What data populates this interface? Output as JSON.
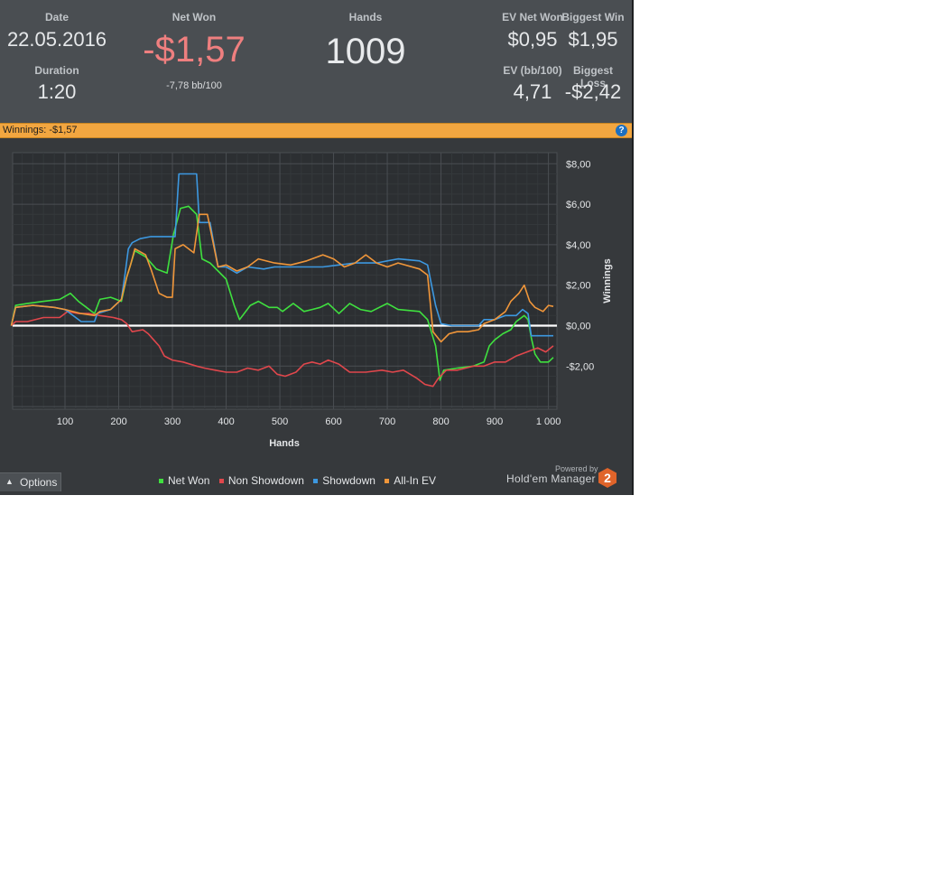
{
  "stats": {
    "date_label": "Date",
    "date_value": "22.05.2016",
    "duration_label": "Duration",
    "duration_value": "1:20",
    "net_won_label": "Net Won",
    "net_won_value": "-$1,57",
    "net_won_bb": "-7,78 bb/100",
    "hands_label": "Hands",
    "hands_value": "1009",
    "ev_net_won_label": "EV Net Won",
    "ev_net_won_value": "$0,95",
    "biggest_win_label": "Biggest Win",
    "biggest_win_value": "$1,95",
    "ev_bb_label": "EV (bb/100)",
    "ev_bb_value": "4,71",
    "biggest_loss_label": "Biggest Loss",
    "biggest_loss_value": "-$2,42"
  },
  "winnings_bar": {
    "label": "Winnings:",
    "value": "-$1,57",
    "help_icon": "help-icon"
  },
  "footer": {
    "options_label": "Options",
    "powered_by": "Powered by",
    "brand_name": "Hold'em Manager",
    "brand_badge": "2"
  },
  "colors": {
    "net_won": "#3fe03f",
    "non_showdown": "#e0474c",
    "showdown": "#3d98e0",
    "all_in_ev": "#f0963a",
    "negative_value": "#ef7f7f",
    "accent_bar": "#f2a640"
  },
  "chart_data": {
    "type": "line",
    "xlabel": "Hands",
    "ylabel": "Winnings",
    "xlim": [
      0,
      1009
    ],
    "ylim": [
      -4.2,
      8.5
    ],
    "x_ticks": [
      100,
      200,
      300,
      400,
      500,
      600,
      700,
      800,
      900,
      1000
    ],
    "x_tick_labels": [
      "100",
      "200",
      "300",
      "400",
      "500",
      "600",
      "700",
      "800",
      "900",
      "1 000"
    ],
    "y_ticks": [
      8,
      6,
      4,
      2,
      0,
      -2
    ],
    "y_tick_labels": [
      "$8,00",
      "$6,00",
      "$4,00",
      "$2,00",
      "$0,00",
      "-$2,00"
    ],
    "grid": true,
    "legend_position": "bottom",
    "series": [
      {
        "name": "Net Won",
        "color_key": "net_won",
        "points": [
          [
            0,
            0
          ],
          [
            8,
            1.0
          ],
          [
            30,
            1.1
          ],
          [
            60,
            1.2
          ],
          [
            90,
            1.3
          ],
          [
            110,
            1.6
          ],
          [
            125,
            1.2
          ],
          [
            140,
            0.9
          ],
          [
            155,
            0.6
          ],
          [
            165,
            1.3
          ],
          [
            185,
            1.4
          ],
          [
            205,
            1.2
          ],
          [
            215,
            2.4
          ],
          [
            222,
            3.0
          ],
          [
            230,
            3.7
          ],
          [
            250,
            3.4
          ],
          [
            270,
            2.8
          ],
          [
            290,
            2.6
          ],
          [
            302,
            4.5
          ],
          [
            315,
            5.8
          ],
          [
            330,
            5.9
          ],
          [
            345,
            5.5
          ],
          [
            355,
            3.3
          ],
          [
            370,
            3.1
          ],
          [
            385,
            2.7
          ],
          [
            400,
            2.3
          ],
          [
            415,
            1.0
          ],
          [
            425,
            0.3
          ],
          [
            445,
            1.0
          ],
          [
            460,
            1.2
          ],
          [
            480,
            0.9
          ],
          [
            495,
            0.9
          ],
          [
            505,
            0.7
          ],
          [
            525,
            1.1
          ],
          [
            545,
            0.7
          ],
          [
            560,
            0.8
          ],
          [
            575,
            0.9
          ],
          [
            590,
            1.1
          ],
          [
            610,
            0.6
          ],
          [
            630,
            1.1
          ],
          [
            650,
            0.8
          ],
          [
            670,
            0.7
          ],
          [
            700,
            1.1
          ],
          [
            720,
            0.8
          ],
          [
            760,
            0.7
          ],
          [
            775,
            0.3
          ],
          [
            790,
            -1.0
          ],
          [
            798,
            -2.7
          ],
          [
            805,
            -2.2
          ],
          [
            830,
            -2.1
          ],
          [
            860,
            -2.0
          ],
          [
            880,
            -1.8
          ],
          [
            890,
            -1.0
          ],
          [
            900,
            -0.7
          ],
          [
            915,
            -0.4
          ],
          [
            930,
            -0.2
          ],
          [
            940,
            0.2
          ],
          [
            955,
            0.5
          ],
          [
            962,
            0.3
          ],
          [
            968,
            -0.6
          ],
          [
            975,
            -1.4
          ],
          [
            985,
            -1.8
          ],
          [
            1000,
            -1.8
          ],
          [
            1009,
            -1.57
          ]
        ]
      },
      {
        "name": "Non Showdown",
        "color_key": "non_showdown",
        "points": [
          [
            0,
            0
          ],
          [
            8,
            0.2
          ],
          [
            30,
            0.2
          ],
          [
            60,
            0.4
          ],
          [
            90,
            0.4
          ],
          [
            105,
            0.7
          ],
          [
            125,
            0.6
          ],
          [
            145,
            0.6
          ],
          [
            165,
            0.5
          ],
          [
            190,
            0.4
          ],
          [
            205,
            0.3
          ],
          [
            215,
            0.1
          ],
          [
            225,
            -0.3
          ],
          [
            245,
            -0.2
          ],
          [
            255,
            -0.4
          ],
          [
            265,
            -0.7
          ],
          [
            275,
            -1.0
          ],
          [
            285,
            -1.5
          ],
          [
            300,
            -1.7
          ],
          [
            320,
            -1.8
          ],
          [
            345,
            -2.0
          ],
          [
            360,
            -2.1
          ],
          [
            380,
            -2.2
          ],
          [
            400,
            -2.3
          ],
          [
            420,
            -2.3
          ],
          [
            440,
            -2.1
          ],
          [
            460,
            -2.2
          ],
          [
            480,
            -2.0
          ],
          [
            495,
            -2.4
          ],
          [
            510,
            -2.5
          ],
          [
            530,
            -2.3
          ],
          [
            545,
            -1.9
          ],
          [
            560,
            -1.8
          ],
          [
            575,
            -1.9
          ],
          [
            590,
            -1.7
          ],
          [
            610,
            -1.9
          ],
          [
            630,
            -2.3
          ],
          [
            660,
            -2.3
          ],
          [
            690,
            -2.2
          ],
          [
            710,
            -2.3
          ],
          [
            730,
            -2.2
          ],
          [
            755,
            -2.6
          ],
          [
            770,
            -2.9
          ],
          [
            785,
            -3.0
          ],
          [
            795,
            -2.6
          ],
          [
            810,
            -2.2
          ],
          [
            830,
            -2.2
          ],
          [
            860,
            -2.0
          ],
          [
            880,
            -2.0
          ],
          [
            900,
            -1.8
          ],
          [
            920,
            -1.8
          ],
          [
            940,
            -1.5
          ],
          [
            960,
            -1.3
          ],
          [
            980,
            -1.1
          ],
          [
            995,
            -1.3
          ],
          [
            1009,
            -1.0
          ]
        ]
      },
      {
        "name": "Showdown",
        "color_key": "showdown",
        "points": [
          [
            0,
            0
          ],
          [
            8,
            0.9
          ],
          [
            40,
            1.0
          ],
          [
            80,
            0.9
          ],
          [
            100,
            0.8
          ],
          [
            130,
            0.2
          ],
          [
            155,
            0.2
          ],
          [
            160,
            0.6
          ],
          [
            185,
            0.8
          ],
          [
            205,
            1.3
          ],
          [
            212,
            2.6
          ],
          [
            218,
            3.8
          ],
          [
            225,
            4.1
          ],
          [
            240,
            4.3
          ],
          [
            260,
            4.4
          ],
          [
            290,
            4.4
          ],
          [
            305,
            4.4
          ],
          [
            312,
            7.5
          ],
          [
            345,
            7.5
          ],
          [
            350,
            5.1
          ],
          [
            370,
            5.1
          ],
          [
            385,
            2.9
          ],
          [
            400,
            2.9
          ],
          [
            420,
            2.6
          ],
          [
            440,
            2.9
          ],
          [
            470,
            2.8
          ],
          [
            490,
            2.9
          ],
          [
            520,
            2.9
          ],
          [
            550,
            2.9
          ],
          [
            580,
            2.9
          ],
          [
            610,
            3.0
          ],
          [
            640,
            3.1
          ],
          [
            660,
            3.1
          ],
          [
            680,
            3.1
          ],
          [
            700,
            3.2
          ],
          [
            720,
            3.3
          ],
          [
            760,
            3.2
          ],
          [
            775,
            3.0
          ],
          [
            790,
            1.0
          ],
          [
            800,
            0.1
          ],
          [
            820,
            0.0
          ],
          [
            850,
            0.0
          ],
          [
            870,
            0.0
          ],
          [
            880,
            0.3
          ],
          [
            900,
            0.3
          ],
          [
            920,
            0.5
          ],
          [
            940,
            0.5
          ],
          [
            952,
            0.8
          ],
          [
            962,
            0.6
          ],
          [
            968,
            -0.5
          ],
          [
            990,
            -0.5
          ],
          [
            1009,
            -0.5
          ]
        ]
      },
      {
        "name": "All-In EV",
        "color_key": "all_in_ev",
        "points": [
          [
            0,
            0
          ],
          [
            8,
            0.9
          ],
          [
            40,
            1.0
          ],
          [
            80,
            0.9
          ],
          [
            100,
            0.8
          ],
          [
            130,
            0.6
          ],
          [
            155,
            0.5
          ],
          [
            165,
            0.7
          ],
          [
            185,
            0.8
          ],
          [
            205,
            1.3
          ],
          [
            215,
            2.4
          ],
          [
            222,
            3.0
          ],
          [
            230,
            3.8
          ],
          [
            250,
            3.5
          ],
          [
            260,
            2.8
          ],
          [
            275,
            1.6
          ],
          [
            290,
            1.4
          ],
          [
            300,
            1.4
          ],
          [
            305,
            3.8
          ],
          [
            320,
            4.0
          ],
          [
            340,
            3.6
          ],
          [
            350,
            5.5
          ],
          [
            365,
            5.5
          ],
          [
            385,
            2.9
          ],
          [
            400,
            3.0
          ],
          [
            420,
            2.7
          ],
          [
            440,
            2.9
          ],
          [
            460,
            3.3
          ],
          [
            490,
            3.1
          ],
          [
            520,
            3.0
          ],
          [
            550,
            3.2
          ],
          [
            580,
            3.5
          ],
          [
            600,
            3.3
          ],
          [
            620,
            2.9
          ],
          [
            640,
            3.1
          ],
          [
            660,
            3.5
          ],
          [
            680,
            3.1
          ],
          [
            700,
            2.9
          ],
          [
            720,
            3.1
          ],
          [
            760,
            2.8
          ],
          [
            775,
            2.5
          ],
          [
            785,
            -0.3
          ],
          [
            800,
            -0.8
          ],
          [
            815,
            -0.4
          ],
          [
            830,
            -0.3
          ],
          [
            850,
            -0.3
          ],
          [
            870,
            -0.2
          ],
          [
            880,
            0.1
          ],
          [
            900,
            0.3
          ],
          [
            920,
            0.7
          ],
          [
            930,
            1.2
          ],
          [
            945,
            1.6
          ],
          [
            955,
            2.0
          ],
          [
            965,
            1.2
          ],
          [
            975,
            0.9
          ],
          [
            990,
            0.7
          ],
          [
            1000,
            1.0
          ],
          [
            1009,
            0.95
          ]
        ]
      }
    ]
  }
}
